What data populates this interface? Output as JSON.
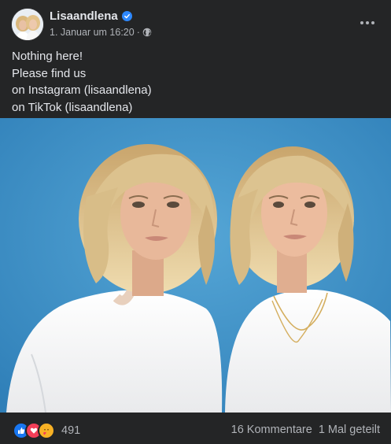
{
  "post": {
    "author": "Lisaandlena",
    "timestamp": "1. Januar um 16:20",
    "separator": "·",
    "audience_icon": "globe-icon",
    "verified_icon": "verified-badge-icon",
    "more_icon": "more-options-icon",
    "text_lines": [
      "Nothing here!",
      "Please find us",
      "on Instagram (lisaandlena)",
      "on TikTok (lisaandlena)"
    ]
  },
  "footer": {
    "reactions": [
      "like-icon",
      "love-icon",
      "care-icon"
    ],
    "reaction_count": "491",
    "comments": "16 Kommentare",
    "shares": "1 Mal geteilt"
  },
  "colors": {
    "background": "#242526",
    "text": "#e4e6eb",
    "secondary_text": "#b0b3b8",
    "accent": "#2d88ff",
    "photo_background": "#3c8cc4"
  }
}
